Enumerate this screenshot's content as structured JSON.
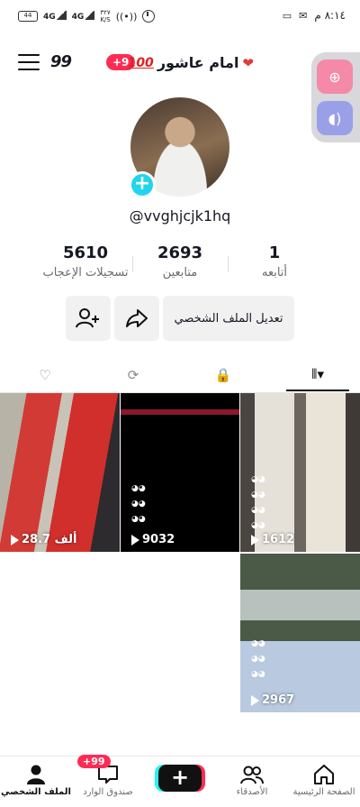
{
  "statusbar": {
    "time": "٨:١٤ م",
    "battery": "44",
    "signal1": "4G",
    "signal2": "4G",
    "netspeed_value": "٣٢٧",
    "netspeed_unit": "K/S"
  },
  "header": {
    "handle_glyph": "99",
    "notif_count": "+9",
    "title_name": "امام عاشور",
    "hundred": "100",
    "heart": "❤"
  },
  "profile": {
    "avatar_add": "+",
    "username": "@vvghjcjk1hq"
  },
  "stats": [
    {
      "value": "1",
      "label": "أتابعه"
    },
    {
      "value": "2693",
      "label": "متابعين"
    },
    {
      "value": "5610",
      "label": "تسجيلات الإعجاب"
    }
  ],
  "actions": {
    "edit_profile": "تعديل الملف الشخصي"
  },
  "tabs": {
    "videos": "⦀▾",
    "private": "🔒",
    "reposts": "⟳",
    "liked": "♡"
  },
  "videos": [
    {
      "views": "28.7 ألف"
    },
    {
      "views": "9032"
    },
    {
      "views": "1612"
    },
    {
      "views": "2967"
    }
  ],
  "nav": {
    "home": "الصفحة الرئيسية",
    "friends": "الأصدقاء",
    "create": "+",
    "inbox": "صندوق الوارد",
    "inbox_badge": "+99",
    "profile": "الملف الشخصي"
  },
  "colors": {
    "accent": "#fe2c55",
    "cyan": "#25f4ee",
    "avatar_add": "#20d5ec"
  }
}
